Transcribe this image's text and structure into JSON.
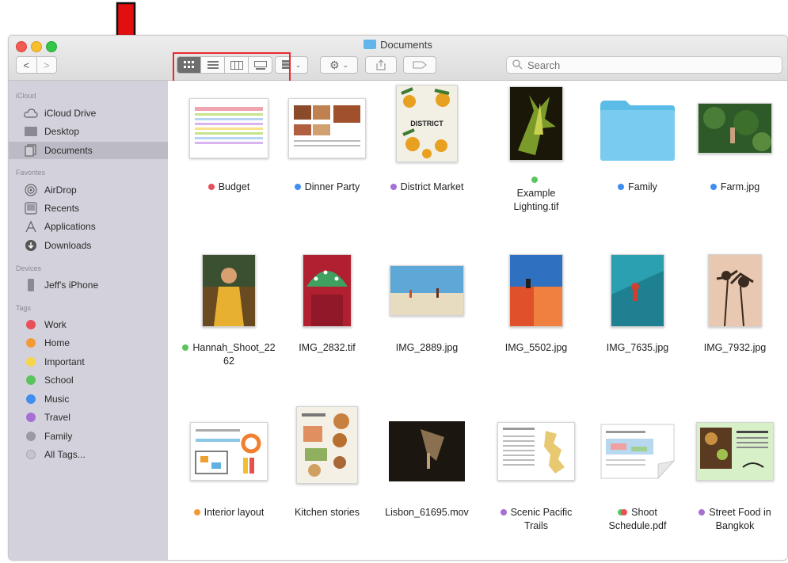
{
  "window": {
    "title": "Documents"
  },
  "toolbar": {
    "back": "<",
    "forward": ">",
    "search_placeholder": "Search"
  },
  "sidebar": {
    "sections": {
      "icloud": "iCloud",
      "favorites": "Favorites",
      "devices": "Devices",
      "tags": "Tags"
    },
    "icloud_items": [
      {
        "label": "iCloud Drive",
        "icon": "cloud-icon"
      },
      {
        "label": "Desktop",
        "icon": "desktop-icon"
      },
      {
        "label": "Documents",
        "icon": "documents-icon",
        "selected": true
      }
    ],
    "favorite_items": [
      {
        "label": "AirDrop",
        "icon": "airdrop-icon"
      },
      {
        "label": "Recents",
        "icon": "recents-icon"
      },
      {
        "label": "Applications",
        "icon": "applications-icon"
      },
      {
        "label": "Downloads",
        "icon": "downloads-icon"
      }
    ],
    "device_items": [
      {
        "label": "Jeff's iPhone",
        "icon": "iphone-icon"
      }
    ],
    "tag_items": [
      {
        "label": "Work",
        "color": "#e8505b"
      },
      {
        "label": "Home",
        "color": "#f39a36"
      },
      {
        "label": "Important",
        "color": "#f6d54a"
      },
      {
        "label": "School",
        "color": "#5cc45c"
      },
      {
        "label": "Music",
        "color": "#3f8ef0"
      },
      {
        "label": "Travel",
        "color": "#a66fd4"
      },
      {
        "label": "Family",
        "color": "#9a9aa2"
      },
      {
        "label": "All Tags...",
        "color": "#c6c6ce"
      }
    ]
  },
  "files": [
    {
      "name": "Budget",
      "tag": "#e8505b"
    },
    {
      "name": "Dinner Party",
      "tag": "#3f8ef0"
    },
    {
      "name": "District Market",
      "tag": "#a66fd4"
    },
    {
      "name_line1": "Example",
      "name_line2": "Lighting.tif",
      "tag": "#5cc45c"
    },
    {
      "name": "Family",
      "tag": "#3f8ef0"
    },
    {
      "name": "Farm.jpg",
      "tag": "#3f8ef0"
    },
    {
      "name_line1": "Hannah_Shoot_22",
      "name_line2": "62",
      "tag": "#5cc45c"
    },
    {
      "name": "IMG_2832.tif"
    },
    {
      "name": "IMG_2889.jpg"
    },
    {
      "name": "IMG_5502.jpg"
    },
    {
      "name": "IMG_7635.jpg"
    },
    {
      "name": "IMG_7932.jpg"
    },
    {
      "name": "Interior layout",
      "tag": "#f39a36"
    },
    {
      "name": "Kitchen stories"
    },
    {
      "name": "Lisbon_61695.mov"
    },
    {
      "name_line1": "Scenic Pacific",
      "name_line2": "Trails",
      "tag": "#a66fd4"
    },
    {
      "name_line1": "Shoot",
      "name_line2": "Schedule.pdf",
      "tags": [
        "#5cc45c",
        "#e8505b"
      ]
    },
    {
      "name_line1": "Street Food in",
      "name_line2": "Bangkok",
      "tag": "#a66fd4"
    }
  ],
  "thumbnail_texts": {
    "district_market": "DISTRICT"
  }
}
